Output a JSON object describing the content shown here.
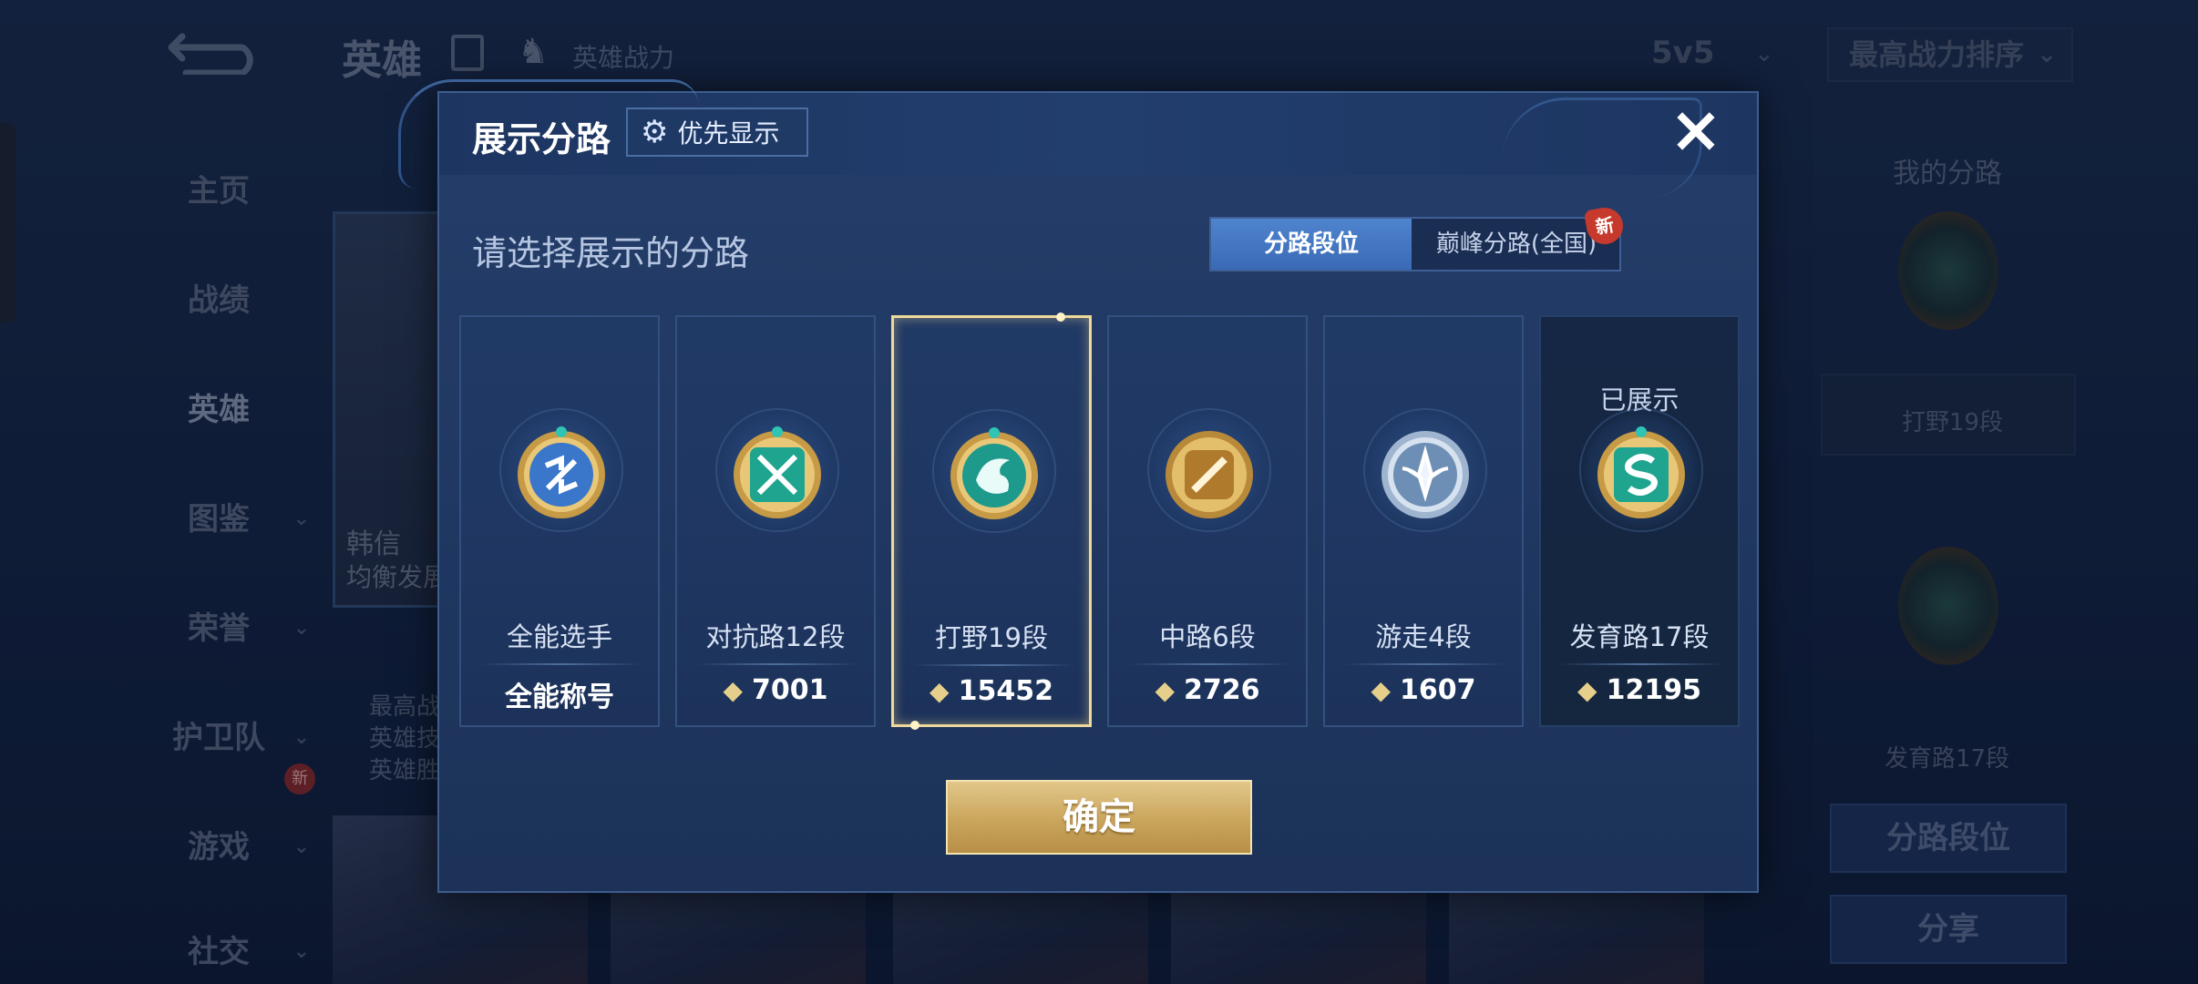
{
  "background": {
    "title": "英雄",
    "power_label": "英雄战力",
    "mode": "5v5",
    "sort": "最高战力排序",
    "sidebar": [
      {
        "label": "主页",
        "chevron": false
      },
      {
        "label": "战绩",
        "chevron": false
      },
      {
        "label": "英雄",
        "chevron": false,
        "active": true
      },
      {
        "label": "图鉴",
        "chevron": true
      },
      {
        "label": "荣誉",
        "chevron": true
      },
      {
        "label": "护卫队",
        "chevron": true
      },
      {
        "label": "游戏",
        "chevron": true
      },
      {
        "label": "社交",
        "chevron": true
      }
    ],
    "sidebar_new_badge": "新",
    "hero": {
      "name": "韩信",
      "subtitle": "均衡发展",
      "stats": [
        "最高战",
        "英雄技",
        "英雄胜"
      ]
    },
    "right": {
      "title": "我的分路",
      "lane1": "打野19段",
      "lane2": "发育路17段",
      "btn_lane_rank": "分路段位",
      "btn_share": "分享"
    }
  },
  "modal": {
    "title": "展示分路",
    "priority_label": "优先显示",
    "close_icon": "×",
    "subtitle": "请选择展示的分路",
    "toggle": {
      "active": "分路段位",
      "inactive": "巅峰分路(全国)",
      "new_badge": "新"
    },
    "displayed_label": "已展示",
    "cards": [
      {
        "name": "全能选手",
        "value": "全能称号",
        "has_score_icon": false,
        "badge": "all-round-emblem-icon",
        "color": "#3a76c9"
      },
      {
        "name": "对抗路12段",
        "value": "7001",
        "has_score_icon": true,
        "badge": "clash-lane-emblem-icon",
        "color": "#1fa58f"
      },
      {
        "name": "打野19段",
        "value": "15452",
        "has_score_icon": true,
        "badge": "jungle-emblem-icon",
        "color": "#1d9a8c",
        "selected": true
      },
      {
        "name": "中路6段",
        "value": "2726",
        "has_score_icon": true,
        "badge": "mid-lane-emblem-icon",
        "color": "#b07a2c"
      },
      {
        "name": "游走4段",
        "value": "1607",
        "has_score_icon": true,
        "badge": "roam-emblem-icon",
        "color": "#6e8fb5"
      },
      {
        "name": "发育路17段",
        "value": "12195",
        "has_score_icon": true,
        "badge": "farm-lane-emblem-icon",
        "color": "#1fa58f",
        "displayed": true
      }
    ],
    "confirm_label": "确定"
  },
  "colors": {
    "accent_gold": "#caa55c",
    "modal_bg": "#223b66",
    "selected_border": "#efd99a",
    "toggle_active": "#4f84cf"
  }
}
